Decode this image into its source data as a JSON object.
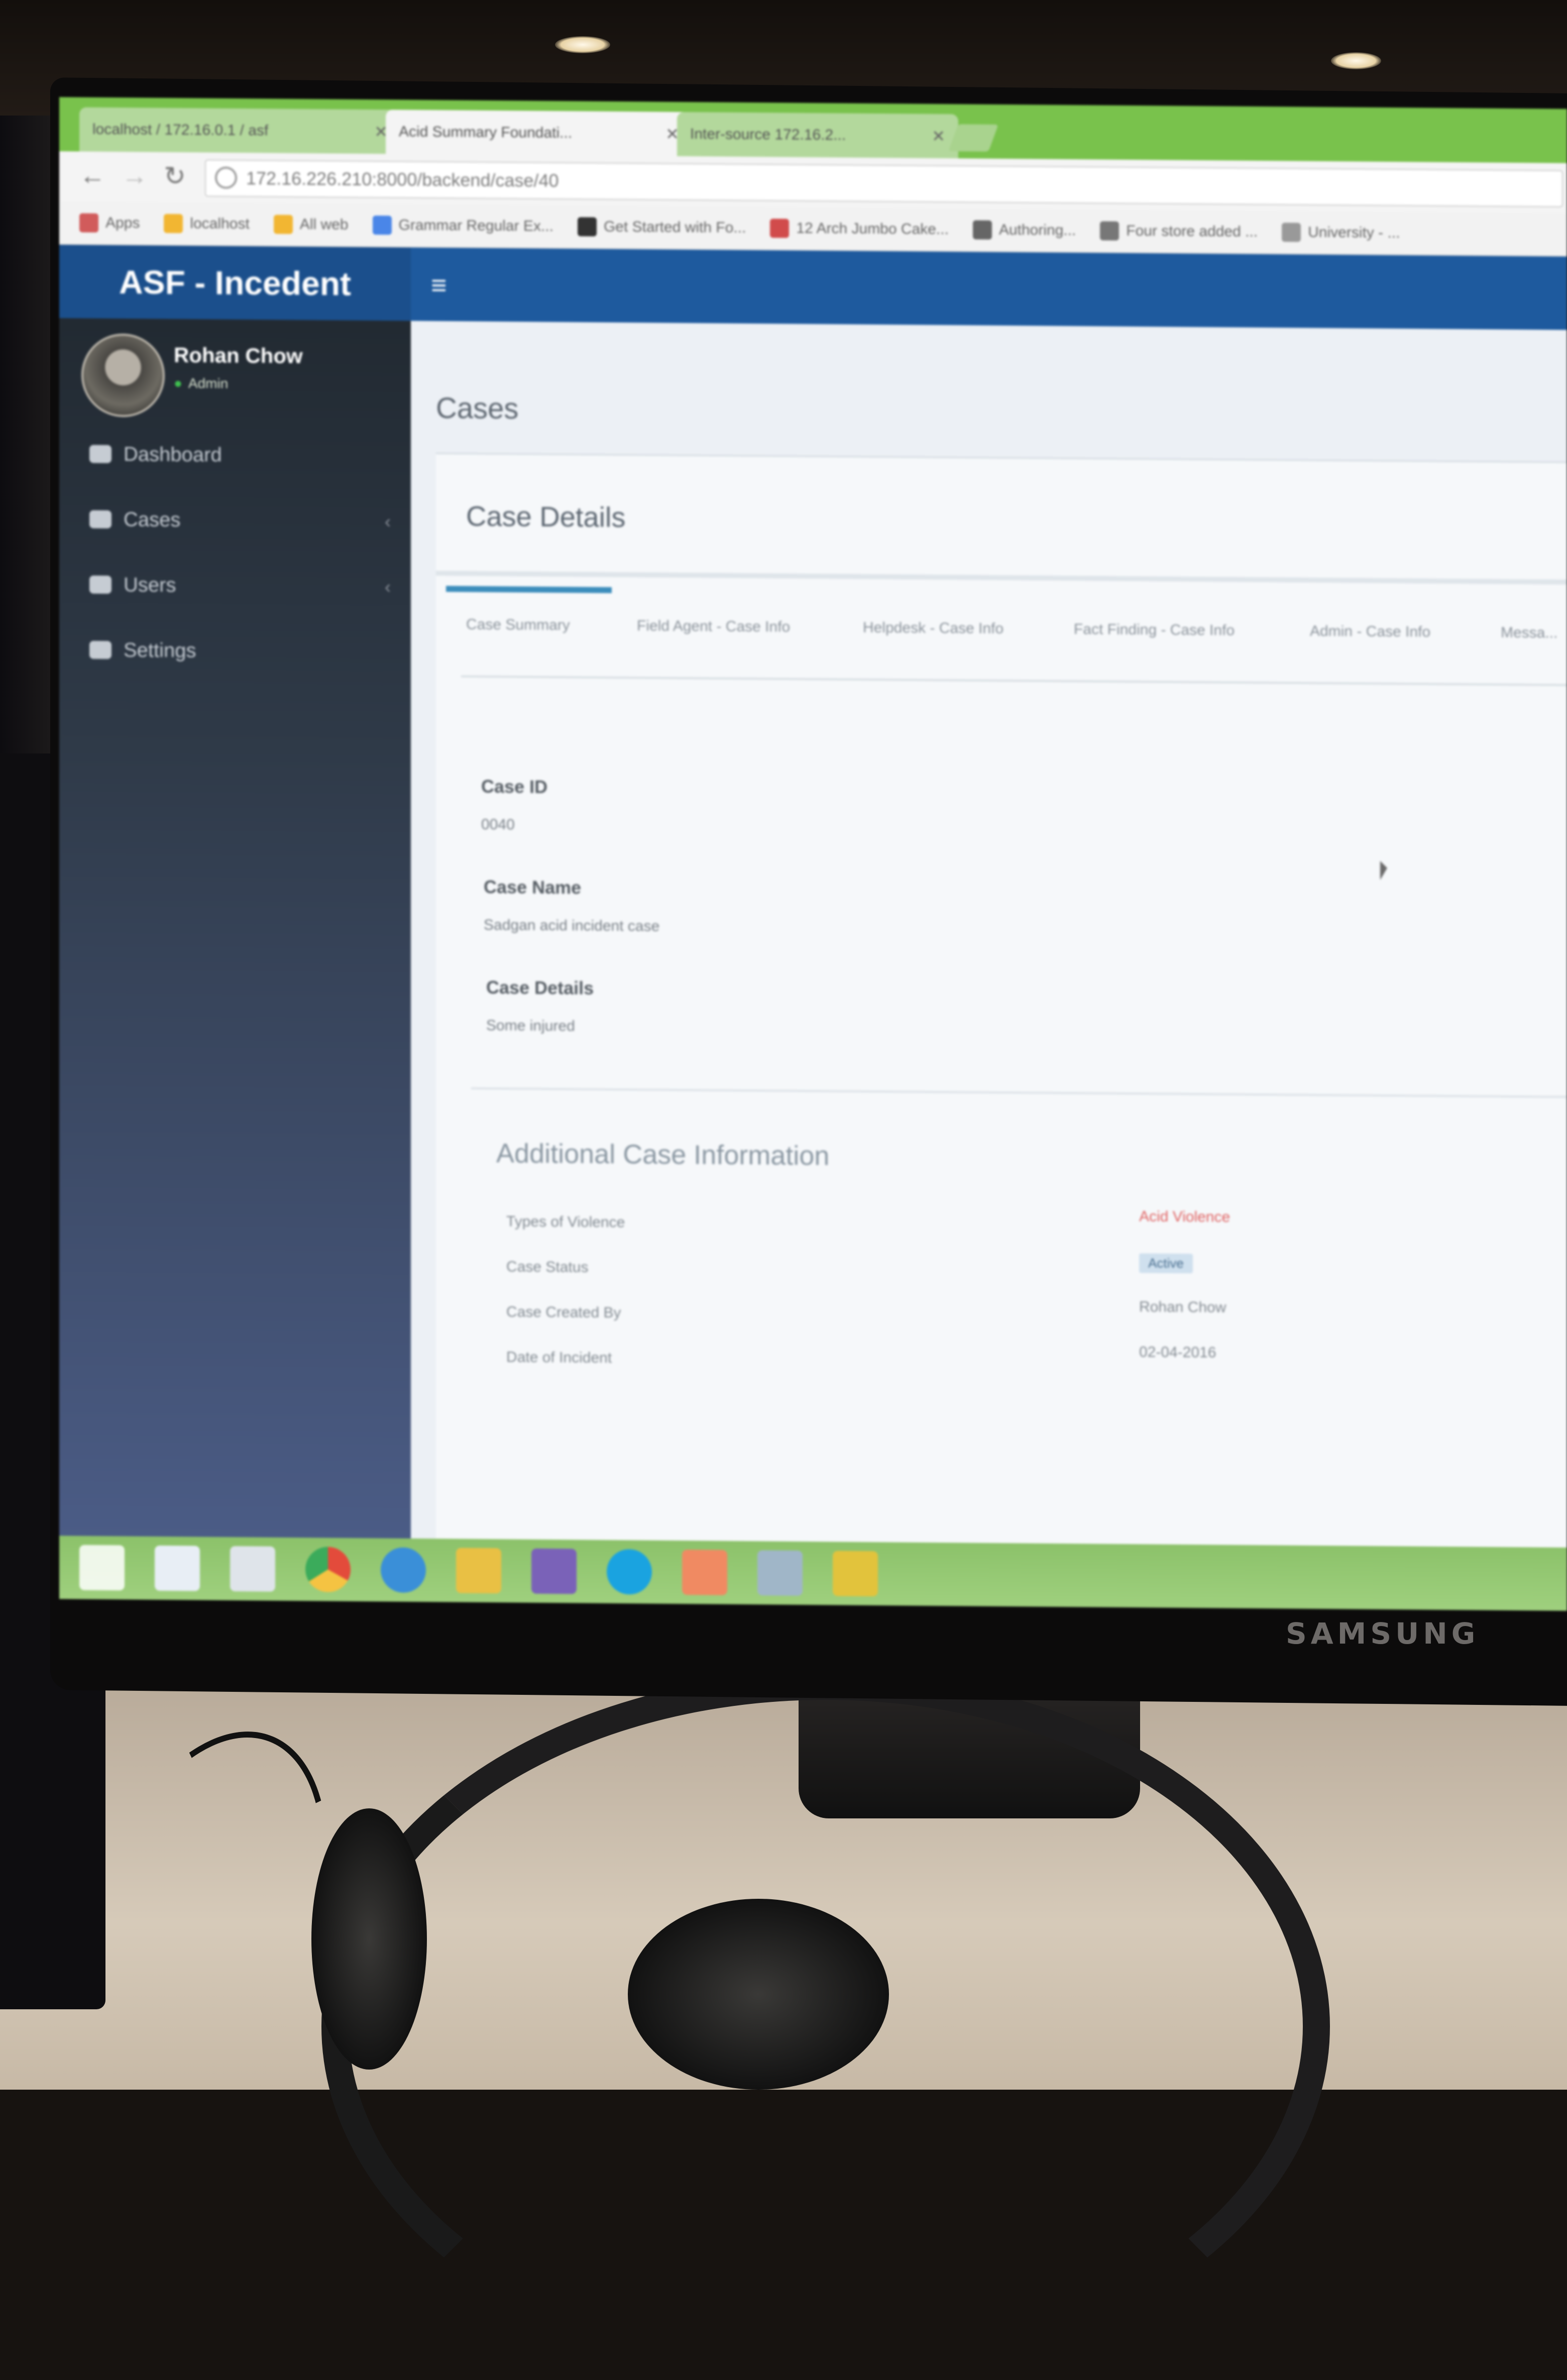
{
  "browser": {
    "tabs": [
      {
        "label": "localhost / 172.16.0.1 / asf",
        "active": false
      },
      {
        "label": "Acid Summary Foundati...",
        "active": true
      },
      {
        "label": "Inter-source 172.16.2...",
        "active": false
      }
    ],
    "address": "172.16.226.210:8000/backend/case/40",
    "bookmarks": [
      {
        "label": "Apps",
        "icon": "apps-grid-icon",
        "color": "#d15b5b"
      },
      {
        "label": "localhost",
        "icon": "folder-icon",
        "color": "#f2b632"
      },
      {
        "label": "All web",
        "icon": "folder-icon",
        "color": "#f2b632"
      },
      {
        "label": "Grammar Regular Ex...",
        "icon": "page-icon",
        "color": "#4a86e8"
      },
      {
        "label": "Get Started with Fo...",
        "icon": "page-icon",
        "color": "#333333"
      },
      {
        "label": "12 Arch Jumbo Cake...",
        "icon": "page-icon",
        "color": "#d14b4b"
      },
      {
        "label": "Authoring...",
        "icon": "page-icon",
        "color": "#666666"
      },
      {
        "label": "Four store added ...",
        "icon": "page-icon",
        "color": "#777777"
      },
      {
        "label": "University - ...",
        "icon": "page-icon",
        "color": "#999999"
      }
    ]
  },
  "app": {
    "brand": "ASF - Incedent",
    "user": {
      "name": "Rohan Chow",
      "role": "Admin"
    },
    "sidebar": [
      {
        "label": "Dashboard",
        "icon": "dashboard-icon",
        "has_chevron": false
      },
      {
        "label": "Cases",
        "icon": "pencil-icon",
        "has_chevron": true
      },
      {
        "label": "Users",
        "icon": "users-icon",
        "has_chevron": true
      },
      {
        "label": "Settings",
        "icon": "folder-icon",
        "has_chevron": false
      }
    ],
    "page_title": "Cases",
    "card_title": "Case Details",
    "tabs": [
      {
        "label": "Case Summary",
        "active": true
      },
      {
        "label": "Field Agent - Case Info",
        "active": false
      },
      {
        "label": "Helpdesk - Case Info",
        "active": false
      },
      {
        "label": "Fact Finding - Case Info",
        "active": false
      },
      {
        "label": "Admin - Case Info",
        "active": false
      },
      {
        "label": "Messa...",
        "active": false
      }
    ],
    "fields": [
      {
        "label": "Case ID",
        "value": "0040"
      },
      {
        "label": "Case Name",
        "value": "Sadgan acid incident case"
      },
      {
        "label": "Case Details",
        "value": "Some injured"
      }
    ],
    "additional_title": "Additional Case Information",
    "additional": [
      {
        "key": "Types of Violence",
        "value": "Acid Violence",
        "style": "red"
      },
      {
        "key": "Case Status",
        "value": "Active",
        "style": "badge"
      },
      {
        "key": "Case Created By",
        "value": "Rohan Chow",
        "style": "plain"
      },
      {
        "key": "Date of Incident",
        "value": "02-04-2016",
        "style": "plain"
      }
    ]
  },
  "taskbar": {
    "apps": [
      {
        "icon": "start-icon",
        "color": "#ffffff"
      },
      {
        "icon": "explorer-icon",
        "color": "#e8eef5"
      },
      {
        "icon": "files-icon",
        "color": "#dfe4ea"
      },
      {
        "icon": "chrome-icon",
        "color": "#e34b3b"
      },
      {
        "icon": "ie-icon",
        "color": "#3a8fd8"
      },
      {
        "icon": "folder-icon",
        "color": "#e9c044"
      },
      {
        "icon": "visual-studio-icon",
        "color": "#7a62b8"
      },
      {
        "icon": "skype-icon",
        "color": "#1aa3e0"
      },
      {
        "icon": "outlook-icon",
        "color": "#f08a62"
      },
      {
        "icon": "network-icon",
        "color": "#a0b6c8"
      },
      {
        "icon": "sticky-notes-icon",
        "color": "#e2c33c"
      }
    ]
  },
  "monitor": {
    "brand": "SAMSUNG"
  }
}
